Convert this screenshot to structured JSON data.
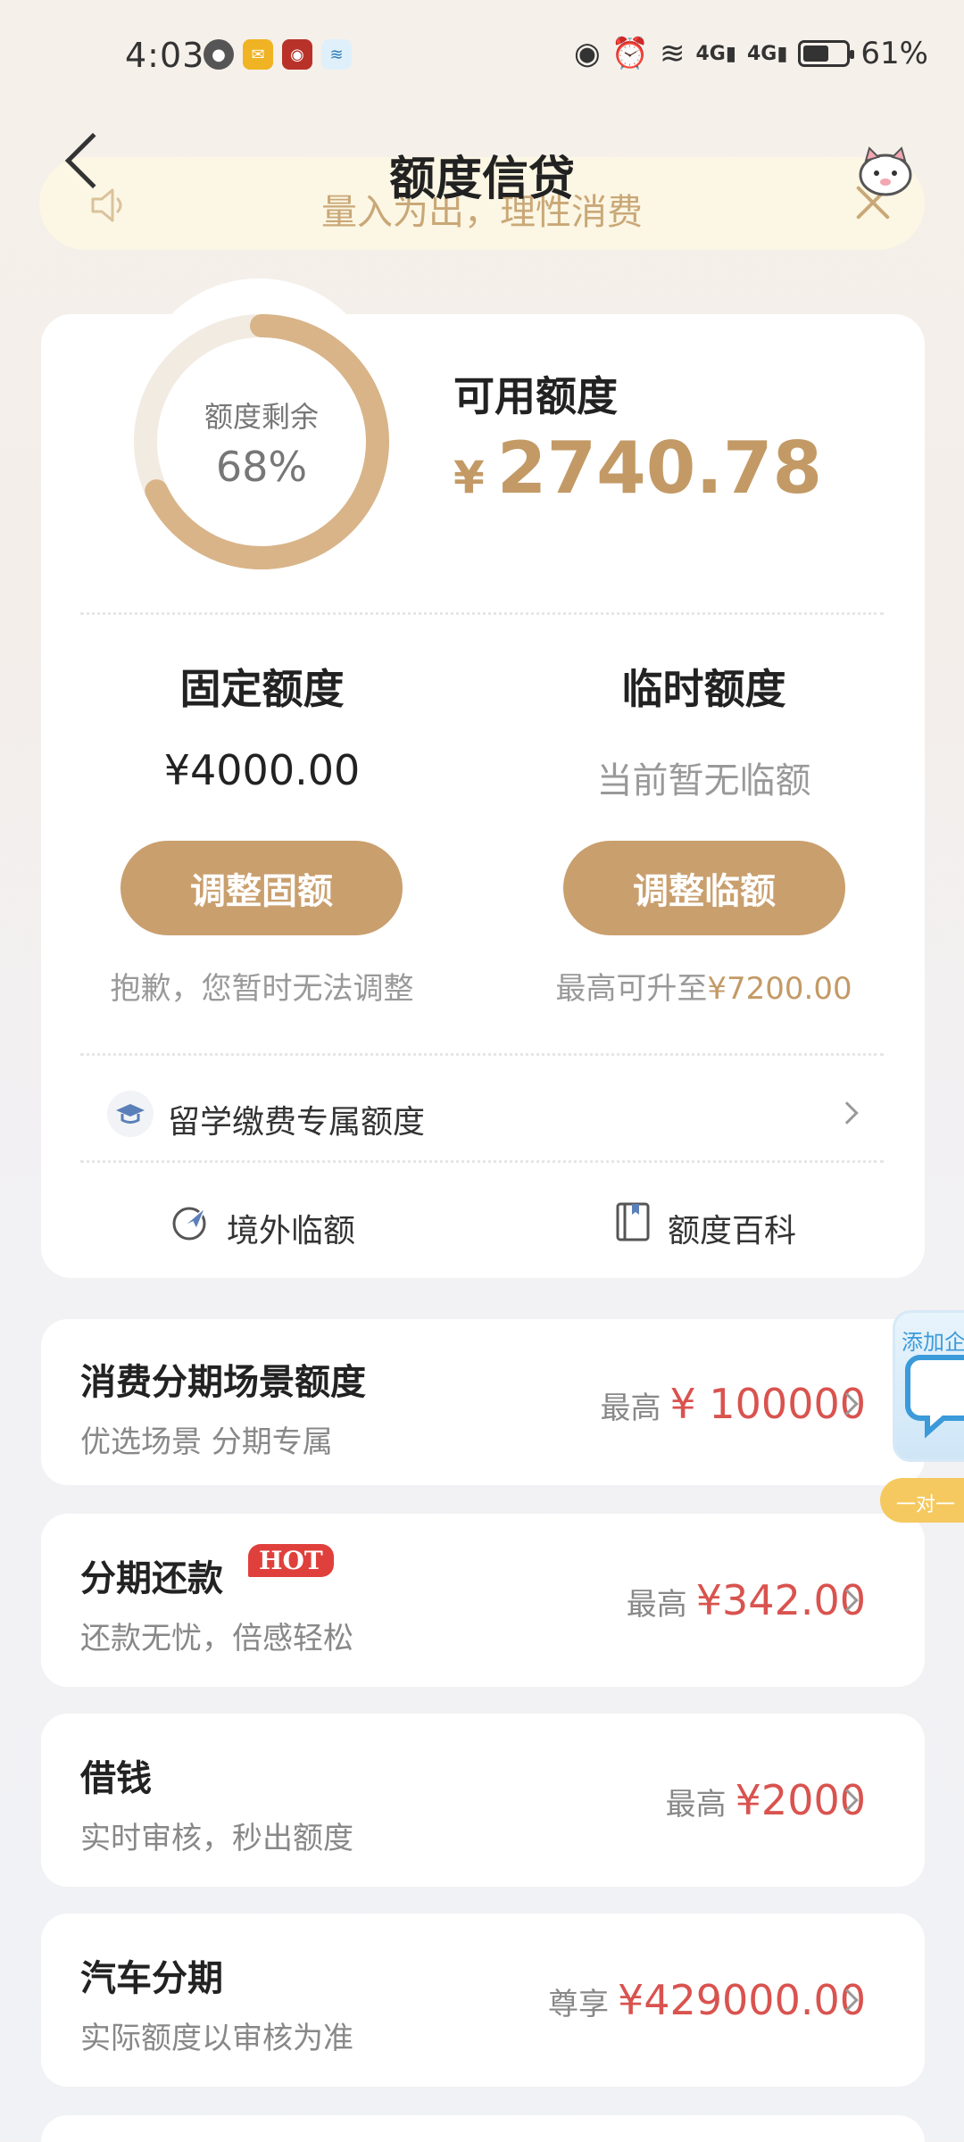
{
  "status_bar": {
    "time": "4:03",
    "signal_1": "4G",
    "signal_2": "4G",
    "battery": "61%",
    "battery_level": 0.61
  },
  "header": {
    "title": "额度信贷",
    "notice": "量入为出，理性消费"
  },
  "credit_summary": {
    "ring_label": "额度剩余",
    "ring_percent": "68%",
    "ring_fraction": 0.68,
    "available_label": "可用额度",
    "currency": "¥",
    "available_amount": "2740.78"
  },
  "fixed_limit": {
    "title": "固定额度",
    "value": "¥4000.00",
    "button": "调整固额",
    "note": "抱歉，您暂时无法调整"
  },
  "temp_limit": {
    "title": "临时额度",
    "value": "当前暂无临额",
    "button": "调整临额",
    "note_prefix": "最高可升至",
    "note_amount": "¥7200.00"
  },
  "links": {
    "study_abroad": "留学缴费专属额度",
    "overseas_temp": "境外临额",
    "encyclopedia": "额度百科"
  },
  "products": [
    {
      "title": "消费分期场景额度",
      "subtitle": "优选场景 分期专属",
      "prefix": "最高",
      "amount": "¥ 100000"
    },
    {
      "title": "分期还款",
      "badge": "HOT",
      "subtitle": "还款无忧，倍感轻松",
      "prefix": "最高",
      "amount": "¥342.00"
    },
    {
      "title": "借钱",
      "subtitle": "实时审核，秒出额度",
      "prefix": "最高",
      "amount": "¥2000"
    },
    {
      "title": "汽车分期",
      "subtitle": "实际额度以审核为准",
      "prefix": "尊享",
      "amount": "¥429000.00"
    }
  ],
  "float_widget": {
    "label": "添加企",
    "badge": "一对一"
  }
}
